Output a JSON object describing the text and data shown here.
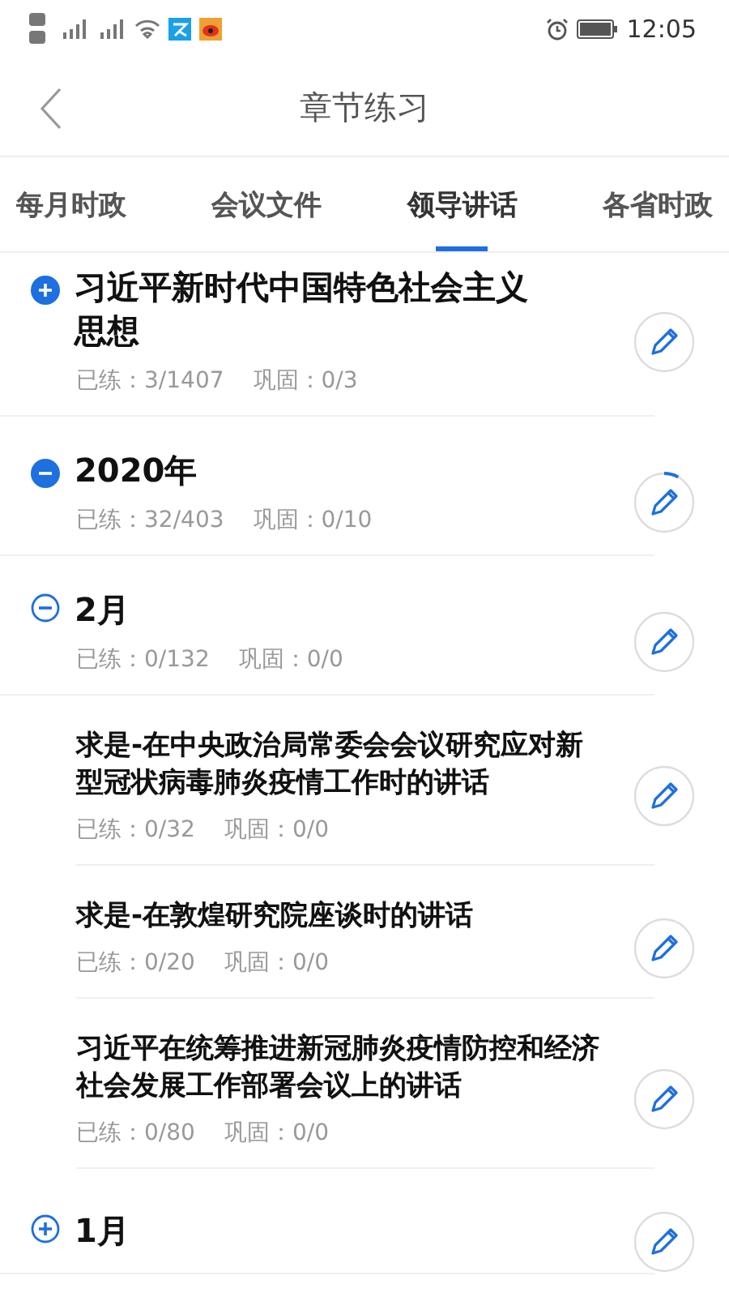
{
  "status_bar": {
    "time": "12:05"
  },
  "header": {
    "title": "章节练习"
  },
  "tabs": [
    {
      "label": "每月时政",
      "selected": false
    },
    {
      "label": "会议文件",
      "selected": false
    },
    {
      "label": "领导讲话",
      "selected": true
    },
    {
      "label": "各省时政",
      "selected": false
    }
  ],
  "chapters": [
    {
      "kind": "group",
      "title": "习近平新时代中国特色社会主义思想",
      "practiced": "已练：3/1407",
      "consolidated": "巩固：0/3",
      "expanded": false
    },
    {
      "kind": "group",
      "title": "2020年",
      "practiced": "已练：32/403",
      "consolidated": "巩固：0/10",
      "expanded": true,
      "children": [
        {
          "kind": "group",
          "title": "2月",
          "practiced": "已练：0/132",
          "consolidated": "巩固：0/0",
          "expanded": true,
          "children": [
            {
              "kind": "leaf",
              "title": "求是-在中央政治局常委会会议研究应对新型冠状病毒肺炎疫情工作时的讲话",
              "practiced": "已练：0/32",
              "consolidated": "巩固：0/0"
            },
            {
              "kind": "leaf",
              "title": "求是-在敦煌研究院座谈时的讲话",
              "practiced": "已练：0/20",
              "consolidated": "巩固：0/0"
            },
            {
              "kind": "leaf",
              "title": "习近平在统筹推进新冠肺炎疫情防控和经济社会发展工作部署会议上的讲话",
              "practiced": "已练：0/80",
              "consolidated": "巩固：0/0"
            }
          ]
        },
        {
          "kind": "group",
          "title": "1月",
          "expanded": false
        }
      ]
    }
  ]
}
